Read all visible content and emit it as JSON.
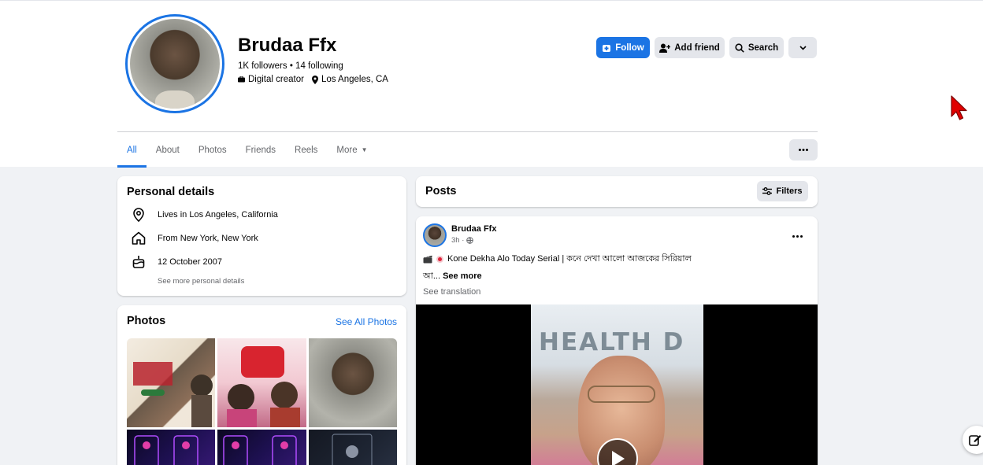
{
  "profile": {
    "name": "Brudaa Ffx",
    "followers_line": "1K followers • 14 following",
    "category": "Digital creator",
    "location": "Los Angeles, CA"
  },
  "actions": {
    "follow": "Follow",
    "add_friend": "Add friend",
    "search": "Search"
  },
  "tabs": [
    {
      "label": "All",
      "active": true
    },
    {
      "label": "About"
    },
    {
      "label": "Photos"
    },
    {
      "label": "Friends"
    },
    {
      "label": "Reels"
    },
    {
      "label": "More"
    }
  ],
  "personal_details": {
    "title": "Personal details",
    "items": [
      {
        "icon": "location-pin-icon",
        "text": "Lives in Los Angeles, California"
      },
      {
        "icon": "home-icon",
        "text": "From New York, New York"
      },
      {
        "icon": "birthday-cake-icon",
        "text": "12 October 2007"
      }
    ],
    "see_more": "See more personal details"
  },
  "photos": {
    "title": "Photos",
    "see_all": "See All Photos"
  },
  "posts": {
    "title": "Posts",
    "filters": "Filters"
  },
  "post": {
    "author": "Brudaa Ffx",
    "time": "3h ·",
    "text_line1": "Kone Dekha Alo Today Serial | কনে দেখা আলো আজকের সিরিয়াল",
    "text_line2_prefix": "আ...",
    "see_more": "See more",
    "see_translation": "See translation",
    "video_sign": "HEALTH D"
  },
  "colors": {
    "accent": "#1b74e4",
    "page_bg": "#f0f2f5",
    "button_gray": "#e4e6eb"
  }
}
